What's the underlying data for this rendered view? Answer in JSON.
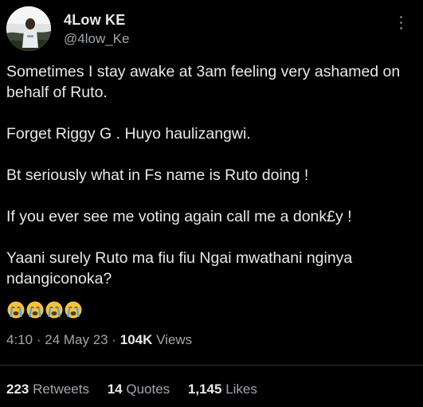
{
  "author": {
    "display_name": "4Low KE",
    "handle": "@4low_Ke"
  },
  "tweet": {
    "lines": [
      "Sometimes I stay awake at 3am feeling very ashamed on behalf of Ruto.",
      "Forget Riggy G . Huyo haulizangwi.",
      "Bt seriously what in Fs name is Ruto doing !",
      "If you ever see me voting again call me a donk£y !",
      "Yaani surely Ruto ma fiu fiu Ngai mwathani nginya ndangiconoka?"
    ],
    "emojis": [
      "loudly-crying-face-icon",
      "loudly-crying-face-icon",
      "loudly-crying-face-icon",
      "loudly-crying-face-icon"
    ]
  },
  "meta": {
    "time": "4:10",
    "separator": "·",
    "date": "24 May 23",
    "views_count": "104K",
    "views_label": "Views"
  },
  "stats": {
    "retweets_count": "223",
    "retweets_label": "Retweets",
    "quotes_count": "14",
    "quotes_label": "Quotes",
    "likes_count": "1,145",
    "likes_label": "Likes"
  },
  "colors": {
    "background": "#000000",
    "text_primary": "#e7e9ea",
    "text_secondary": "#a0a6aa",
    "divider": "#2f3336"
  }
}
